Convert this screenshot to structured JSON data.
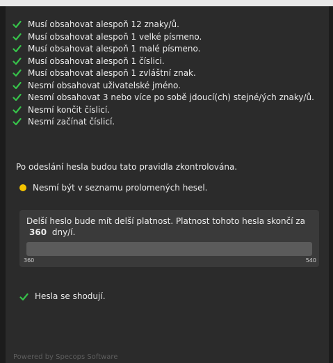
{
  "rules": [
    {
      "text": "Musí obsahovat alespoň 12 znaky/ů.",
      "status": "ok"
    },
    {
      "text": "Musí obsahovat alespoň 1 velké písmeno.",
      "status": "ok"
    },
    {
      "text": "Musí obsahovat alespoň 1 malé písmeno.",
      "status": "ok"
    },
    {
      "text": "Musí obsahovat alespoň 1 číslici.",
      "status": "ok"
    },
    {
      "text": "Musí obsahovat alespoň 1 zvláštní znak.",
      "status": "ok"
    },
    {
      "text": "Nesmí obsahovat uživatelské jméno.",
      "status": "ok"
    },
    {
      "text": "Nesmí obsahovat 3 nebo více po sobě jdoucí(ch) stejné/ých znaky/ů.",
      "status": "ok"
    },
    {
      "text": "Nesmí končit číslicí.",
      "status": "ok"
    },
    {
      "text": "Nesmí začínat číslicí.",
      "status": "ok"
    }
  ],
  "info": "Po odeslání hesla budou tato pravidla zkontrolována.",
  "breached": {
    "text": "Nesmí být v seznamu prolomených hesel.",
    "status": "pending"
  },
  "validity": {
    "text_before": "Delší heslo bude mít delší platnost. Platnost tohoto hesla skončí za",
    "days": "360",
    "text_after": "dny/í.",
    "min": "360",
    "max": "540",
    "progress": 0
  },
  "match": {
    "text": "Hesla se shodují.",
    "status": "ok"
  },
  "footer": "Powered by Specops Software",
  "colors": {
    "check": "#37c24a",
    "pending": "#f5c400"
  }
}
